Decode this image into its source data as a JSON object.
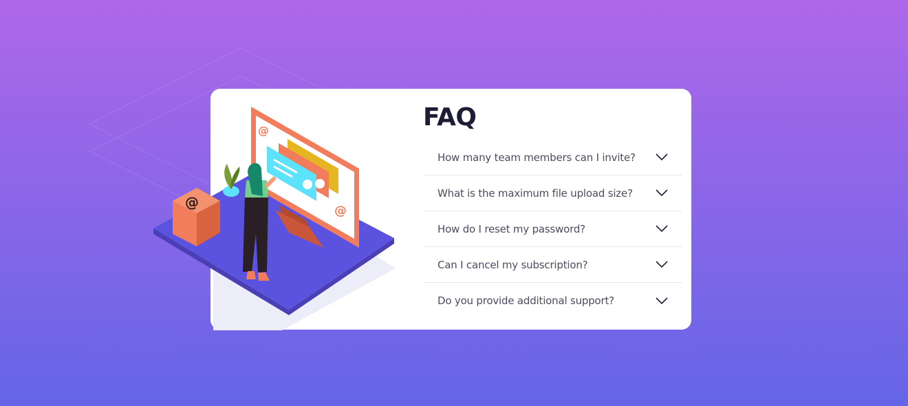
{
  "page": {
    "background_top": "#af67e9",
    "background_bottom": "#6565e7",
    "card_background": "#ffffff"
  },
  "faq": {
    "title": "FAQ",
    "items": [
      {
        "question": "How many team members can I invite?",
        "expanded": false
      },
      {
        "question": "What is the maximum file upload size?",
        "expanded": false
      },
      {
        "question": "How do I reset my password?",
        "expanded": false
      },
      {
        "question": "Can I cancel my subscription?",
        "expanded": false
      },
      {
        "question": "Do you provide additional support?",
        "expanded": false
      }
    ],
    "toggle_icon": "chevron-down-icon"
  },
  "illustration": {
    "subject": "woman-at-online-monitor",
    "box_symbol": "@",
    "screen_symbol": "@",
    "colors": {
      "platform": "#5b52df",
      "monitor_frame": "#f27d5c",
      "box_front": "#f27d5c",
      "message_blue": "#5ce2fa",
      "message_yellow": "#f2c23d",
      "plant": "#7a9e3a"
    }
  }
}
